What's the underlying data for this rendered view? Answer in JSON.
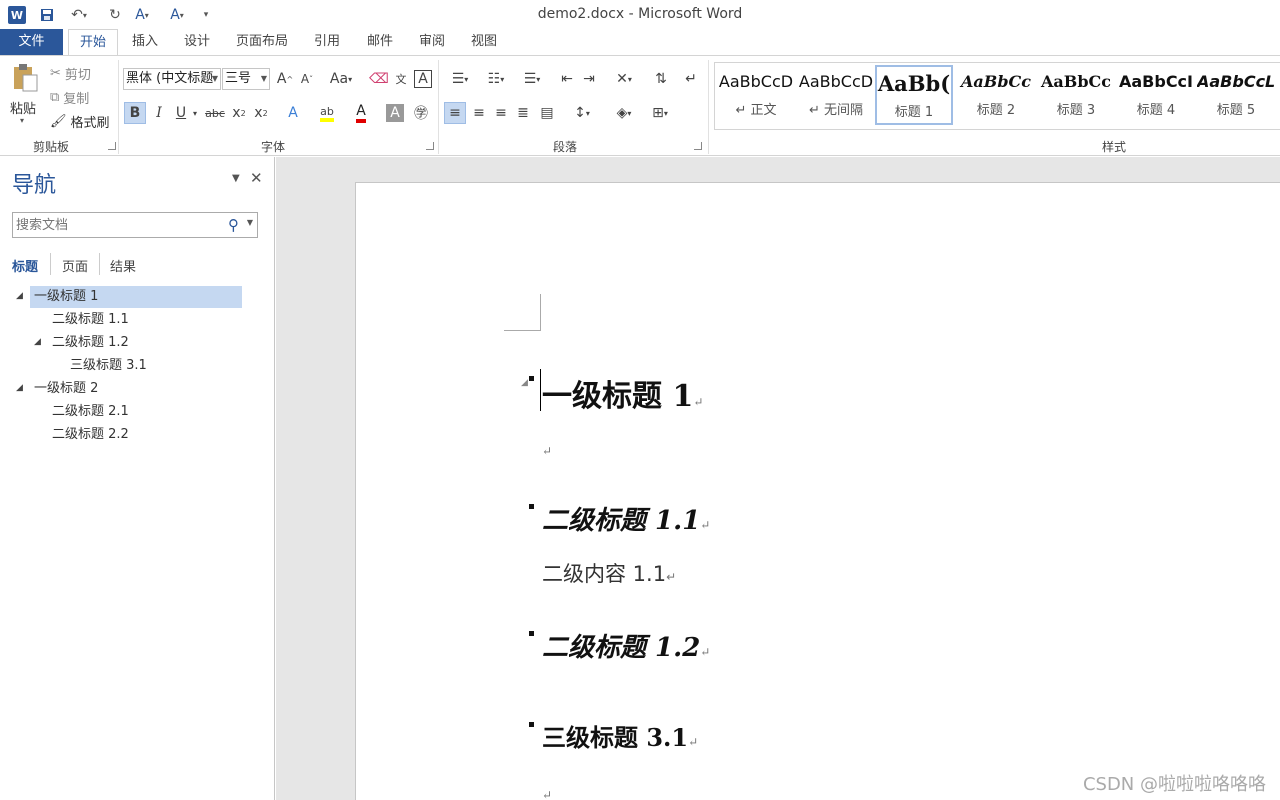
{
  "window": {
    "title": "demo2.docx - Microsoft Word",
    "logo_letter": "W"
  },
  "tabs": [
    {
      "label": "文件"
    },
    {
      "label": "开始"
    },
    {
      "label": "插入"
    },
    {
      "label": "设计"
    },
    {
      "label": "页面布局"
    },
    {
      "label": "引用"
    },
    {
      "label": "邮件"
    },
    {
      "label": "审阅"
    },
    {
      "label": "视图"
    }
  ],
  "clipboard": {
    "paste_label": "粘贴",
    "cut_label": "剪切",
    "copy_label": "复制",
    "format_painter_label": "格式刷",
    "group_label": "剪贴板"
  },
  "font": {
    "font_name": "黑体 (中文标题",
    "font_size": "三号",
    "group_label": "字体"
  },
  "paragraph": {
    "group_label": "段落"
  },
  "styles": {
    "group_label": "样式",
    "items": [
      {
        "sample": "AaBbCcD",
        "name": "↵ 正文"
      },
      {
        "sample": "AaBbCcD",
        "name": "↵ 无间隔"
      },
      {
        "sample": "AaBb(",
        "name": "标题 1"
      },
      {
        "sample": "AaBbCc",
        "name": "标题 2"
      },
      {
        "sample": "AaBbCc",
        "name": "标题 3"
      },
      {
        "sample": "AaBbCcI",
        "name": "标题 4"
      },
      {
        "sample": "AaBbCcL",
        "name": "标题 5"
      }
    ]
  },
  "nav": {
    "title": "导航",
    "search_placeholder": "搜索文档",
    "tabs": [
      {
        "label": "标题"
      },
      {
        "label": "页面"
      },
      {
        "label": "结果"
      }
    ],
    "tree": [
      {
        "label": "一级标题 1"
      },
      {
        "label": "二级标题 1.1"
      },
      {
        "label": "二级标题 1.2"
      },
      {
        "label": "三级标题 3.1"
      },
      {
        "label": "一级标题 2"
      },
      {
        "label": "二级标题 2.1"
      },
      {
        "label": "二级标题 2.2"
      }
    ]
  },
  "document": {
    "h1": "一级标题  1",
    "h2_1": "二级标题  1.1",
    "body_1": "二级内容 1.1",
    "h2_2": "二级标题  1.2",
    "h3_1": "三级标题  3.1",
    "para_mark": "↵"
  },
  "watermark": "CSDN @啦啦啦咯咯咯"
}
